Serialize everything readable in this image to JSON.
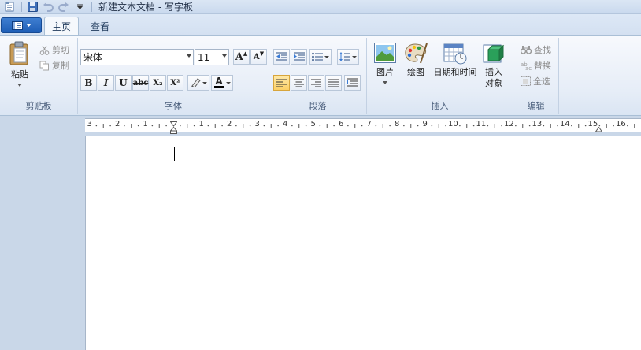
{
  "window": {
    "title": "新建文本文档 - 写字板"
  },
  "tabs": [
    {
      "label": "主页",
      "active": true
    },
    {
      "label": "查看",
      "active": false
    }
  ],
  "ribbon": {
    "clipboard": {
      "group_label": "剪贴板",
      "paste_label": "粘贴",
      "cut_label": "剪切",
      "copy_label": "复制"
    },
    "font": {
      "group_label": "字体",
      "font_name": "宋体",
      "font_size": "11",
      "grow_label": "A",
      "shrink_label": "A",
      "bold_label": "B",
      "italic_label": "I",
      "underline_label": "U",
      "strike_label": "abc",
      "subscript_label": "X₂",
      "superscript_label": "X²",
      "font_color_label": "A"
    },
    "paragraph": {
      "group_label": "段落"
    },
    "insert": {
      "group_label": "插入",
      "picture_label": "图片",
      "paint_label": "绘图",
      "datetime_label": "日期和时间",
      "object_label_line1": "插入",
      "object_label_line2": "对象"
    },
    "editing": {
      "group_label": "编辑",
      "find_label": "查找",
      "replace_label": "替换",
      "selectall_label": "全选"
    }
  },
  "ruler": {
    "labels": [
      "3",
      "2",
      "1",
      "1",
      "2",
      "3",
      "4",
      "5",
      "6",
      "7",
      "8",
      "9",
      "10",
      "11",
      "12",
      "13",
      "14",
      "15",
      "16"
    ]
  },
  "colors": {
    "accent": "#1e5db6",
    "highlight_active": "#fbd067",
    "font_color_bar": "#000000",
    "highlight_bar": "#ffff00"
  }
}
